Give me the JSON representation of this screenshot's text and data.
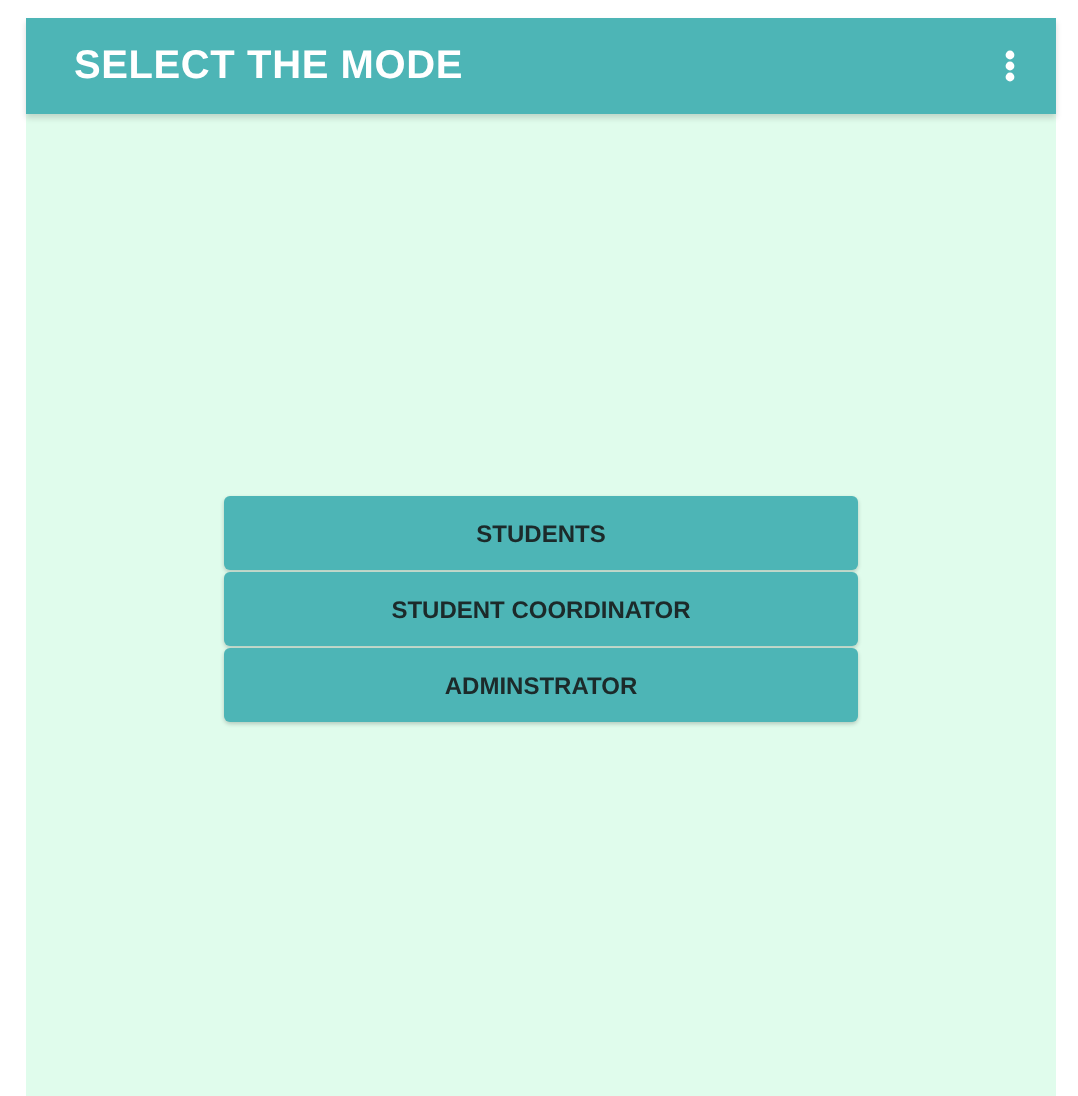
{
  "app_bar": {
    "title": "SELECT THE MODE"
  },
  "buttons": [
    {
      "label": "STUDENTS"
    },
    {
      "label": "STUDENT COORDINATOR"
    },
    {
      "label": "ADMINSTRATOR"
    }
  ]
}
